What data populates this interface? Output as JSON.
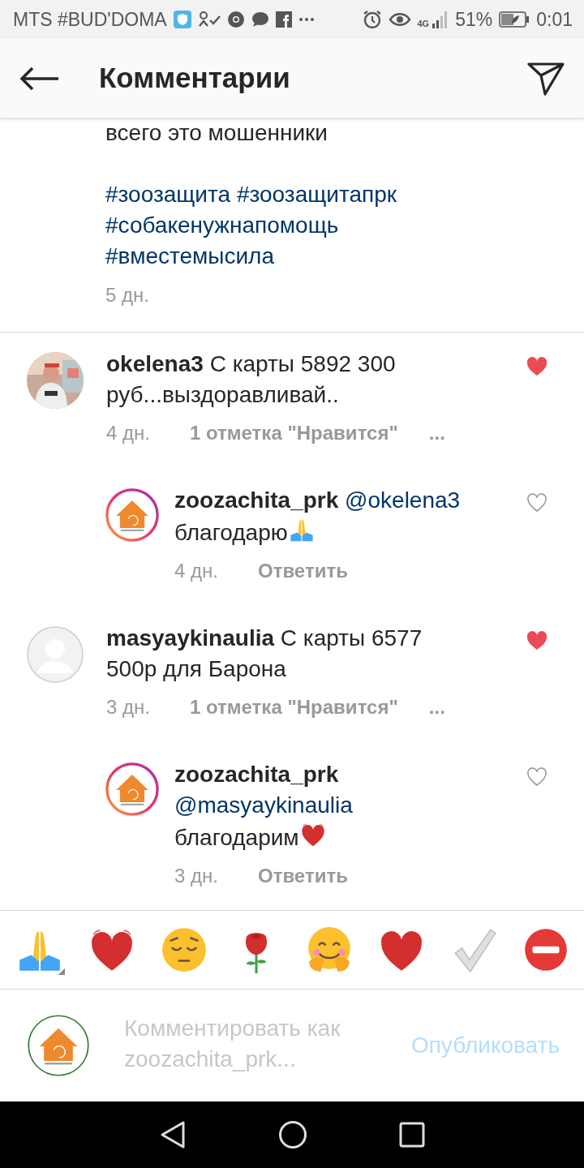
{
  "status_bar": {
    "carrier": "MTS #BUD'DOMA",
    "network": "4G",
    "battery": "51%",
    "time": "0:01"
  },
  "header": {
    "title": "Комментарии"
  },
  "caption": {
    "text": "всего это мошенники",
    "hashtags": [
      "#зоозащита",
      "#зоозащитапрк",
      "#собакенужнапомощь",
      "#вместемысила"
    ],
    "time": "5 дн."
  },
  "comments": [
    {
      "kind": "comment",
      "username": "okelena3",
      "text": "С карты 5892 300 руб...выздоравливай..",
      "time": "4 дн.",
      "likes": "1 отметка \"Нравится\"",
      "more": "...",
      "liked": true
    },
    {
      "kind": "reply",
      "avatar": {
        "kind": "logo"
      },
      "username": "zoozachita_prk",
      "mention": "@okelena3",
      "text": "благодарю",
      "emoji": {
        "kind": "pray"
      },
      "time": "4 дн.",
      "action": "Ответить",
      "liked": false
    },
    {
      "kind": "comment",
      "avatar": {
        "kind": "blank"
      },
      "username": "masyaykinaulia",
      "text": "С карты 6577 500р для Барона",
      "time": "3 дн.",
      "likes": "1 отметка \"Нравится\"",
      "more": "...",
      "liked": true
    },
    {
      "kind": "reply",
      "avatar": {
        "kind": "logo"
      },
      "username": "zoozachita_prk",
      "mention": "@masyaykinaulia",
      "text": "благодарим",
      "emoji": {
        "kind": "beating-heart"
      },
      "time": "3 дн.",
      "action": "Ответить",
      "liked": false
    }
  ],
  "emoji_bar": [
    {
      "kind": "pray"
    },
    {
      "kind": "beating-heart"
    },
    {
      "kind": "pensive"
    },
    {
      "kind": "rose"
    },
    {
      "kind": "hug"
    },
    {
      "kind": "heart"
    },
    {
      "kind": "check"
    },
    {
      "kind": "no-entry"
    }
  ],
  "composer": {
    "placeholder": "Комментировать как zoozachita_prk...",
    "publish": "Опубликовать",
    "disabled": true
  }
}
